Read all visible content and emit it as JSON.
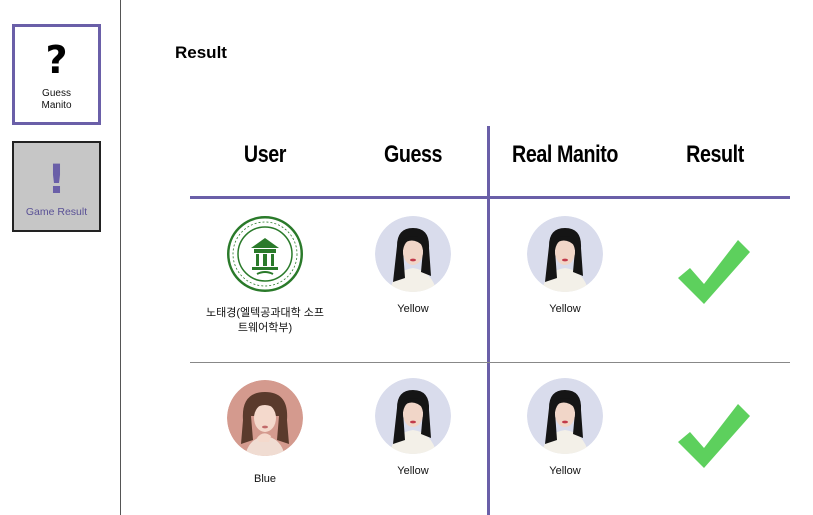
{
  "sidebar": {
    "guess": {
      "icon": "question-mark-icon",
      "glyph": "?",
      "label": "Guess Manito"
    },
    "result": {
      "icon": "exclamation-icon",
      "glyph": "!",
      "label": "Game Result"
    }
  },
  "page": {
    "title": "Result"
  },
  "table": {
    "headers": [
      "User",
      "Guess",
      "Real Manito",
      "Result"
    ],
    "rows": [
      {
        "user": "노태경(엘텍공과대학 소프트웨어학부)",
        "user_avatar": "university-seal-icon",
        "guess": "Yellow",
        "guess_avatar": "portrait-photo",
        "real": "Yellow",
        "real_avatar": "portrait-photo",
        "result": "check-icon"
      },
      {
        "user": "Blue",
        "user_avatar": "portrait-photo",
        "guess": "Yellow",
        "guess_avatar": "portrait-photo",
        "real": "Yellow",
        "real_avatar": "portrait-photo",
        "result": "check-icon"
      }
    ]
  },
  "colors": {
    "accent": "#6a5fa8",
    "check": "#5dd05d",
    "nav_active_bg": "#c6c6c6"
  }
}
